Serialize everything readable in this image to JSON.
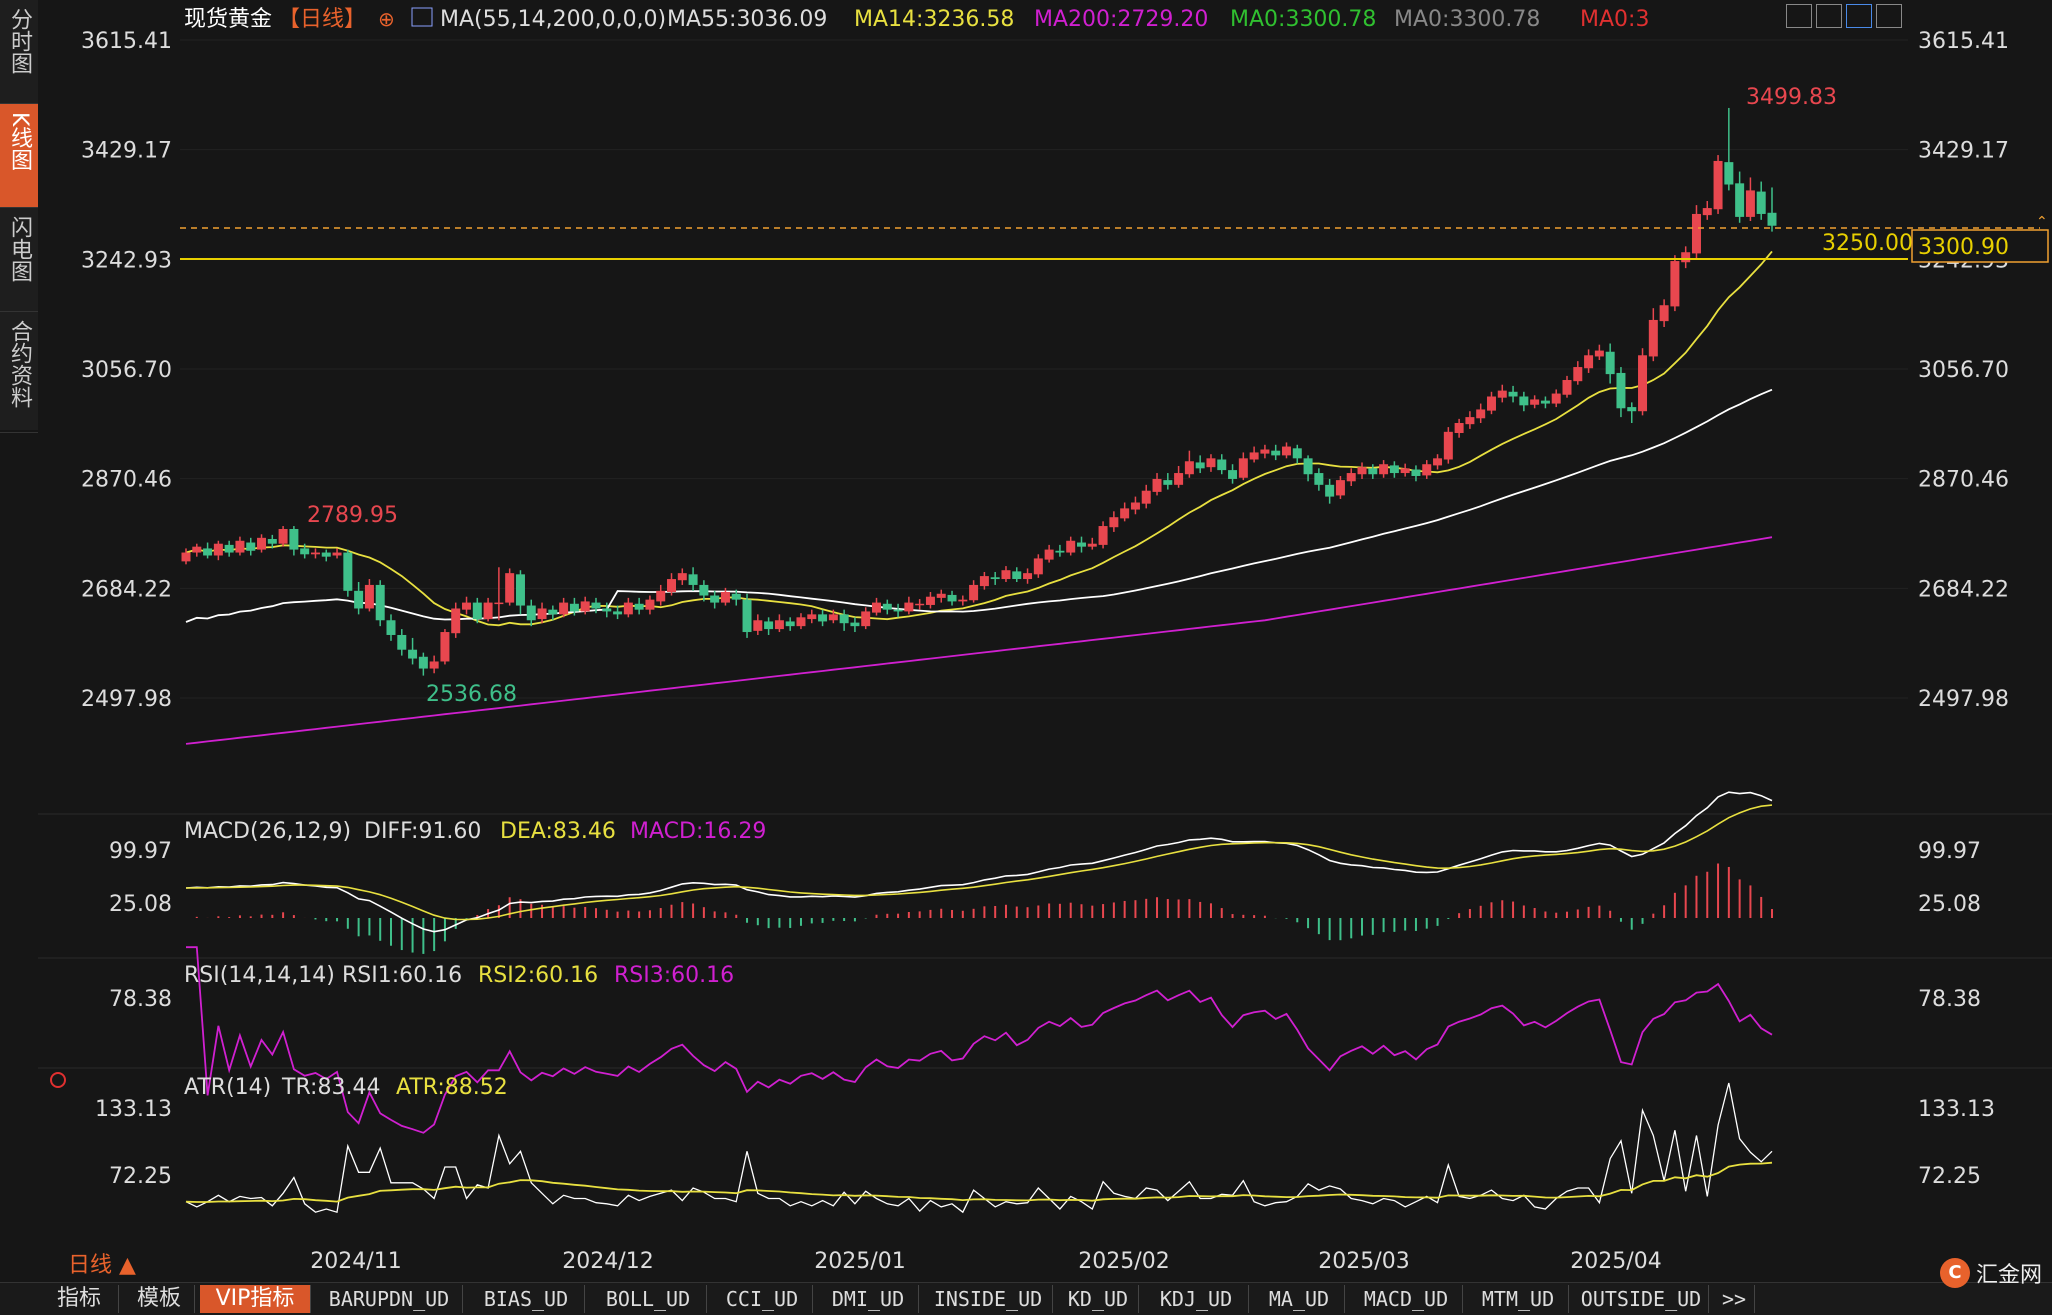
{
  "side_tabs": [
    "分时图",
    "K线图",
    "闪电图",
    "合约资料"
  ],
  "active_side_tab": 1,
  "header": {
    "instrument": "现货黄金",
    "period": "【日线】",
    "ma_params": "MA(55,14,200,0,0,0)",
    "ma55": "MA55:3036.09",
    "ma14": "MA14:3236.58",
    "ma200": "MA200:2729.20",
    "ma0a": "MA0:3300.78",
    "ma0b": "MA0:3300.78",
    "ma0c": "MA0:3"
  },
  "price_levels": [
    "3615.41",
    "3429.17",
    "3242.93",
    "3056.70",
    "2870.46",
    "2684.22",
    "2497.98"
  ],
  "annotations": {
    "high": "3499.83",
    "low": "2536.68",
    "mid_high": "2789.95",
    "level_line": "3250.00",
    "last_price": "3300.90"
  },
  "macd": {
    "title": "MACD(26,12,9)",
    "diff": "DIFF:91.60",
    "dea": "DEA:83.46",
    "macd": "MACD:16.29",
    "ticks": [
      "99.97",
      "25.08"
    ]
  },
  "rsi": {
    "title": "RSI(14,14,14)",
    "rsi1": "RSI1:60.16",
    "rsi2": "RSI2:60.16",
    "rsi3": "RSI3:60.16",
    "ticks": [
      "78.38"
    ]
  },
  "atr": {
    "title": "ATR(14)",
    "tr": "TR:83.44",
    "atr": "ATR:88.52",
    "ticks": [
      "133.13",
      "72.25"
    ]
  },
  "x_labels": [
    "2024/11",
    "2024/12",
    "2025/01",
    "2025/02",
    "2025/03",
    "2025/04"
  ],
  "period_button": "日线 ▲",
  "bottom_tabs": [
    "指标",
    "模板",
    "VIP指标",
    "BARUPDN_UD",
    "BIAS_UD",
    "BOLL_UD",
    "CCI_UD",
    "DMI_UD",
    "INSIDE_UD",
    "KD_UD",
    "KDJ_UD",
    "MA_UD",
    "MACD_UD",
    "MTM_UD",
    "OUTSIDE_UD",
    ">>"
  ],
  "active_bottom_tab": 2,
  "logo_text": "汇金网",
  "colors": {
    "up": "#e8474f",
    "down": "#3fc08a",
    "ma14": "#e8e040",
    "ma55": "#ffffff",
    "ma200": "#d020d0",
    "accent": "#d9572a",
    "level": "#e8d000",
    "dashed": "#f0a030"
  },
  "chart_data": {
    "type": "candlestick",
    "y_range": [
      2400,
      3650
    ],
    "x_categories": [
      "2024/11",
      "2024/12",
      "2025/01",
      "2025/02",
      "2025/03",
      "2025/04"
    ],
    "candles": [
      [
        2730,
        2745,
        2725,
        2752
      ],
      [
        2745,
        2755,
        2738,
        2760
      ],
      [
        2752,
        2740,
        2735,
        2762
      ],
      [
        2740,
        2760,
        2732,
        2765
      ],
      [
        2758,
        2745,
        2738,
        2765
      ],
      [
        2745,
        2765,
        2740,
        2772
      ],
      [
        2762,
        2748,
        2740,
        2770
      ],
      [
        2750,
        2770,
        2745,
        2776
      ],
      [
        2768,
        2760,
        2752,
        2775
      ],
      [
        2760,
        2785,
        2755,
        2790
      ],
      [
        2785,
        2750,
        2740,
        2790
      ],
      [
        2752,
        2742,
        2735,
        2760
      ],
      [
        2742,
        2745,
        2735,
        2752
      ],
      [
        2745,
        2738,
        2730,
        2750
      ],
      [
        2740,
        2745,
        2735,
        2752
      ],
      [
        2745,
        2680,
        2670,
        2750
      ],
      [
        2680,
        2650,
        2640,
        2695
      ],
      [
        2650,
        2690,
        2645,
        2700
      ],
      [
        2690,
        2630,
        2620,
        2698
      ],
      [
        2630,
        2605,
        2595,
        2640
      ],
      [
        2605,
        2580,
        2570,
        2615
      ],
      [
        2580,
        2565,
        2555,
        2600
      ],
      [
        2568,
        2548,
        2536,
        2575
      ],
      [
        2548,
        2560,
        2540,
        2570
      ],
      [
        2560,
        2610,
        2555,
        2615
      ],
      [
        2608,
        2650,
        2600,
        2660
      ],
      [
        2648,
        2660,
        2640,
        2670
      ],
      [
        2660,
        2632,
        2625,
        2668
      ],
      [
        2632,
        2660,
        2628,
        2668
      ],
      [
        2660,
        2660,
        2630,
        2720
      ],
      [
        2660,
        2710,
        2655,
        2718
      ],
      [
        2708,
        2655,
        2640,
        2715
      ],
      [
        2655,
        2630,
        2620,
        2665
      ],
      [
        2632,
        2650,
        2625,
        2660
      ],
      [
        2648,
        2640,
        2630,
        2655
      ],
      [
        2640,
        2660,
        2635,
        2668
      ],
      [
        2658,
        2645,
        2638,
        2668
      ],
      [
        2645,
        2662,
        2640,
        2670
      ],
      [
        2660,
        2650,
        2642,
        2668
      ],
      [
        2650,
        2645,
        2635,
        2660
      ],
      [
        2645,
        2640,
        2632,
        2655
      ],
      [
        2640,
        2660,
        2635,
        2668
      ],
      [
        2658,
        2648,
        2640,
        2668
      ],
      [
        2648,
        2665,
        2640,
        2672
      ],
      [
        2662,
        2680,
        2655,
        2690
      ],
      [
        2678,
        2700,
        2672,
        2710
      ],
      [
        2698,
        2710,
        2690,
        2718
      ],
      [
        2708,
        2690,
        2680,
        2720
      ],
      [
        2690,
        2672,
        2662,
        2698
      ],
      [
        2672,
        2660,
        2650,
        2680
      ],
      [
        2660,
        2678,
        2655,
        2685
      ],
      [
        2675,
        2665,
        2655,
        2682
      ],
      [
        2665,
        2610,
        2600,
        2675
      ],
      [
        2612,
        2630,
        2605,
        2640
      ],
      [
        2628,
        2615,
        2605,
        2635
      ],
      [
        2615,
        2630,
        2610,
        2640
      ],
      [
        2628,
        2620,
        2612,
        2635
      ],
      [
        2620,
        2635,
        2615,
        2642
      ],
      [
        2632,
        2640,
        2625,
        2648
      ],
      [
        2640,
        2628,
        2620,
        2648
      ],
      [
        2630,
        2640,
        2625,
        2648
      ],
      [
        2640,
        2625,
        2612,
        2648
      ],
      [
        2626,
        2620,
        2610,
        2635
      ],
      [
        2620,
        2645,
        2615,
        2652
      ],
      [
        2643,
        2660,
        2638,
        2668
      ],
      [
        2658,
        2648,
        2640,
        2665
      ],
      [
        2648,
        2645,
        2635,
        2658
      ],
      [
        2645,
        2660,
        2640,
        2670
      ],
      [
        2658,
        2658,
        2648,
        2666
      ],
      [
        2656,
        2670,
        2650,
        2678
      ],
      [
        2668,
        2675,
        2660,
        2682
      ],
      [
        2673,
        2662,
        2655,
        2680
      ],
      [
        2662,
        2665,
        2655,
        2672
      ],
      [
        2664,
        2690,
        2660,
        2698
      ],
      [
        2688,
        2705,
        2682,
        2712
      ],
      [
        2703,
        2700,
        2690,
        2712
      ],
      [
        2700,
        2715,
        2695,
        2722
      ],
      [
        2713,
        2700,
        2695,
        2720
      ],
      [
        2700,
        2710,
        2692,
        2718
      ],
      [
        2708,
        2735,
        2702,
        2742
      ],
      [
        2733,
        2750,
        2728,
        2758
      ],
      [
        2748,
        2745,
        2738,
        2758
      ],
      [
        2745,
        2765,
        2740,
        2772
      ],
      [
        2762,
        2755,
        2745,
        2772
      ],
      [
        2755,
        2760,
        2750,
        2770
      ],
      [
        2758,
        2790,
        2752,
        2798
      ],
      [
        2788,
        2805,
        2780,
        2815
      ],
      [
        2803,
        2820,
        2798,
        2830
      ],
      [
        2818,
        2830,
        2810,
        2840
      ],
      [
        2828,
        2850,
        2820,
        2860
      ],
      [
        2848,
        2870,
        2842,
        2880
      ],
      [
        2868,
        2860,
        2852,
        2880
      ],
      [
        2860,
        2880,
        2855,
        2892
      ],
      [
        2878,
        2900,
        2872,
        2918
      ],
      [
        2898,
        2888,
        2880,
        2910
      ],
      [
        2890,
        2905,
        2882,
        2912
      ],
      [
        2903,
        2885,
        2878,
        2912
      ],
      [
        2885,
        2870,
        2862,
        2895
      ],
      [
        2872,
        2905,
        2868,
        2915
      ],
      [
        2903,
        2915,
        2898,
        2925
      ],
      [
        2913,
        2920,
        2905,
        2928
      ],
      [
        2918,
        2910,
        2902,
        2928
      ],
      [
        2910,
        2925,
        2905,
        2932
      ],
      [
        2922,
        2905,
        2896,
        2928
      ],
      [
        2905,
        2878,
        2866,
        2910
      ],
      [
        2880,
        2860,
        2850,
        2888
      ],
      [
        2860,
        2840,
        2828,
        2870
      ],
      [
        2842,
        2868,
        2836,
        2875
      ],
      [
        2866,
        2880,
        2858,
        2888
      ],
      [
        2878,
        2890,
        2870,
        2898
      ],
      [
        2888,
        2878,
        2870,
        2895
      ],
      [
        2878,
        2895,
        2872,
        2902
      ],
      [
        2893,
        2880,
        2872,
        2900
      ],
      [
        2880,
        2888,
        2874,
        2896
      ],
      [
        2886,
        2875,
        2866,
        2893
      ],
      [
        2876,
        2895,
        2870,
        2902
      ],
      [
        2893,
        2905,
        2886,
        2912
      ],
      [
        2903,
        2950,
        2896,
        2958
      ],
      [
        2948,
        2965,
        2940,
        2972
      ],
      [
        2963,
        2975,
        2955,
        2985
      ],
      [
        2973,
        2988,
        2965,
        2998
      ],
      [
        2986,
        3010,
        2980,
        3018
      ],
      [
        3008,
        3020,
        3000,
        3030
      ],
      [
        3018,
        3010,
        3000,
        3028
      ],
      [
        3010,
        2995,
        2985,
        3018
      ],
      [
        2996,
        3005,
        2990,
        3012
      ],
      [
        3003,
        2998,
        2990,
        3010
      ],
      [
        2998,
        3015,
        2992,
        3022
      ],
      [
        3013,
        3038,
        3008,
        3045
      ],
      [
        3036,
        3060,
        3030,
        3070
      ],
      [
        3058,
        3080,
        3050,
        3090
      ],
      [
        3078,
        3088,
        3072,
        3098
      ],
      [
        3086,
        3048,
        3032,
        3100
      ],
      [
        3050,
        2990,
        2975,
        3060
      ],
      [
        2992,
        2985,
        2965,
        3000
      ],
      [
        2985,
        3080,
        2978,
        3092
      ],
      [
        3078,
        3140,
        3070,
        3160
      ],
      [
        3138,
        3165,
        3128,
        3175
      ],
      [
        3163,
        3240,
        3155,
        3250
      ],
      [
        3238,
        3255,
        3228,
        3265
      ],
      [
        3253,
        3320,
        3245,
        3335
      ],
      [
        3318,
        3330,
        3310,
        3342
      ],
      [
        3328,
        3410,
        3320,
        3420
      ],
      [
        3408,
        3370,
        3360,
        3500
      ],
      [
        3372,
        3315,
        3305,
        3392
      ],
      [
        3315,
        3360,
        3308,
        3382
      ],
      [
        3358,
        3320,
        3310,
        3375
      ],
      [
        3322,
        3300,
        3290,
        3365
      ]
    ],
    "ma_series": [
      {
        "name": "MA14",
        "color": "#e8e040"
      },
      {
        "name": "MA55",
        "color": "#ffffff"
      },
      {
        "name": "MA200",
        "color": "#d020d0"
      }
    ]
  }
}
